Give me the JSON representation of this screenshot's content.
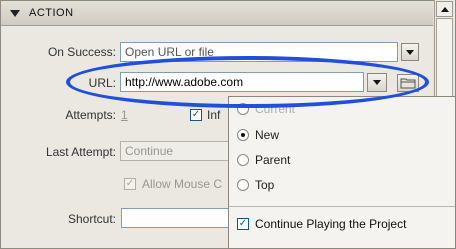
{
  "header": {
    "title": "ACTION"
  },
  "form": {
    "on_success_label": "On Success:",
    "on_success_value": "Open URL or file",
    "url_label": "URL:",
    "url_value": "http://www.adobe.com",
    "attempts_label": "Attempts:",
    "attempts_value": "1",
    "infinite_label": "Inf",
    "last_attempt_label": "Last Attempt:",
    "last_attempt_value": "Continue",
    "allow_mouse_label": "Allow Mouse C",
    "shortcut_label": "Shortcut:",
    "shortcut_value": ""
  },
  "window_menu": {
    "options": [
      {
        "label": "Current",
        "selected": false,
        "faded": true
      },
      {
        "label": "New",
        "selected": true,
        "faded": false
      },
      {
        "label": "Parent",
        "selected": false,
        "faded": false
      },
      {
        "label": "Top",
        "selected": false,
        "faded": false
      }
    ],
    "continue_label": "Continue Playing the Project",
    "continue_checked": true
  },
  "colors": {
    "highlight": "#1f4fdb",
    "panel": "#ebe8e2"
  }
}
